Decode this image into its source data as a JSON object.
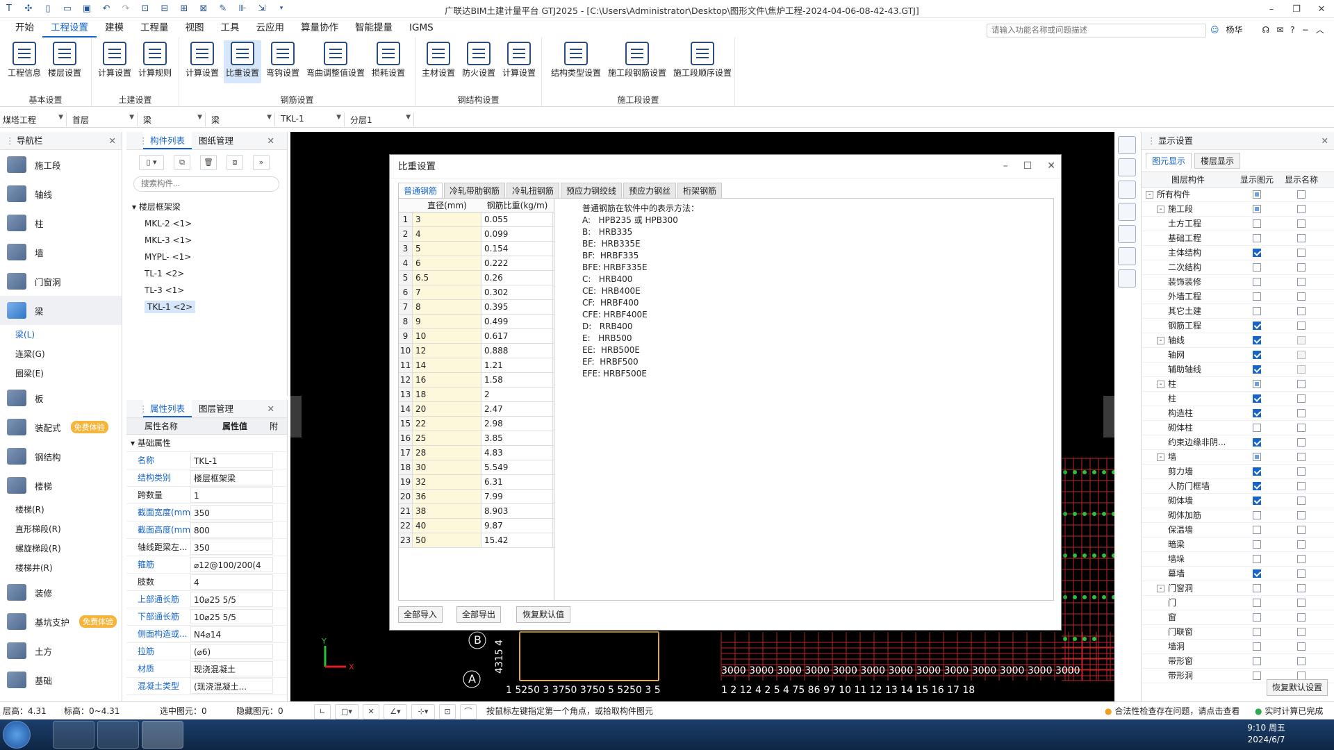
{
  "titlebar": {
    "title": "广联达BIM土建计量平台 GTJ2025 - [C:\\Users\\Administrator\\Desktop\\图形文件\\焦炉工程-2024-04-06-08-42-43.GTJ]"
  },
  "menu": [
    "开始",
    "工程设置",
    "建模",
    "工程量",
    "视图",
    "工具",
    "云应用",
    "算量协作",
    "智能提量",
    "IGMS"
  ],
  "search": {
    "placeholder": "请输入功能名称或问题描述"
  },
  "user": {
    "name": "杨华"
  },
  "ribbon": {
    "groups": [
      {
        "label": "基本设置",
        "buttons": [
          "工程信息",
          "楼层设置"
        ]
      },
      {
        "label": "土建设置",
        "buttons": [
          "计算设置",
          "计算规则"
        ]
      },
      {
        "label": "钢筋设置",
        "buttons": [
          "计算设置",
          "比重设置",
          "弯钩设置",
          "弯曲调整值设置",
          "损耗设置"
        ]
      },
      {
        "label": "钢结构设置",
        "buttons": [
          "主材设置",
          "防火设置",
          "计算设置"
        ]
      },
      {
        "label": "施工段设置",
        "buttons": [
          "结构类型设置",
          "施工段钢筋设置",
          "施工段顺序设置"
        ]
      }
    ]
  },
  "selectors": [
    "煤塔工程",
    "首层",
    "梁",
    "梁",
    "TKL-1",
    "分层1"
  ],
  "nav": {
    "title": "导航栏",
    "items": [
      "施工段",
      "轴线",
      "柱",
      "墙",
      "门窗洞",
      "梁",
      "板",
      "装配式",
      "钢结构",
      "楼梯",
      "装修",
      "基坑支护",
      "土方",
      "基础"
    ],
    "beam_subs": [
      "梁(L)",
      "连梁(G)",
      "圈梁(E)"
    ],
    "stair_subs": [
      "楼梯(R)",
      "直形梯段(R)",
      "螺旋梯段(R)",
      "楼梯井(R)"
    ],
    "badge": "免费体验"
  },
  "complist": {
    "tabs": [
      "构件列表",
      "图纸管理"
    ],
    "search_placeholder": "搜索构件...",
    "group": "楼层框架梁",
    "items": [
      "MKL-2 <1>",
      "MKL-3 <1>",
      "MYPL- <1>",
      "TL-1 <2>",
      "TL-3 <1>",
      "TKL-1 <2>"
    ]
  },
  "props": {
    "tabs": [
      "属性列表",
      "图层管理"
    ],
    "col_name": "属性名称",
    "col_value": "属性值",
    "col_extra": "附",
    "section": "基础属性",
    "rows": [
      {
        "name": "名称",
        "value": "TKL-1"
      },
      {
        "name": "结构类别",
        "value": "楼层框架梁"
      },
      {
        "name": "跨数量",
        "value": "1"
      },
      {
        "name": "截面宽度(mm)",
        "value": "350"
      },
      {
        "name": "截面高度(mm)",
        "value": "800"
      },
      {
        "name": "轴线距梁左...",
        "value": "350"
      },
      {
        "name": "箍筋",
        "value": "⌀12@100/200(4"
      },
      {
        "name": "肢数",
        "value": "4"
      },
      {
        "name": "上部通长筋",
        "value": "10⌀25 5/5"
      },
      {
        "name": "下部通长筋",
        "value": "10⌀25 5/5"
      },
      {
        "name": "侧面构造或...",
        "value": "N4⌀14"
      },
      {
        "name": "拉筋",
        "value": "(⌀6)"
      },
      {
        "name": "材质",
        "value": "现浇混凝土"
      },
      {
        "name": "混凝土类型",
        "value": "(现浇混凝土..."
      }
    ]
  },
  "dialog": {
    "title": "比重设置",
    "tabs": [
      "普通钢筋",
      "冷轧带肋钢筋",
      "冷轧扭钢筋",
      "预应力钢绞线",
      "预应力钢丝",
      "桁架钢筋"
    ],
    "col_dia": "直径(mm)",
    "col_weight": "钢筋比重(kg/m)",
    "rows": [
      {
        "n": "1",
        "d": "3",
        "w": "0.055"
      },
      {
        "n": "2",
        "d": "4",
        "w": "0.099"
      },
      {
        "n": "3",
        "d": "5",
        "w": "0.154"
      },
      {
        "n": "4",
        "d": "6",
        "w": "0.222"
      },
      {
        "n": "5",
        "d": "6.5",
        "w": "0.26"
      },
      {
        "n": "6",
        "d": "7",
        "w": "0.302"
      },
      {
        "n": "7",
        "d": "8",
        "w": "0.395"
      },
      {
        "n": "8",
        "d": "9",
        "w": "0.499"
      },
      {
        "n": "9",
        "d": "10",
        "w": "0.617"
      },
      {
        "n": "10",
        "d": "12",
        "w": "0.888"
      },
      {
        "n": "11",
        "d": "14",
        "w": "1.21"
      },
      {
        "n": "12",
        "d": "16",
        "w": "1.58"
      },
      {
        "n": "13",
        "d": "18",
        "w": "2"
      },
      {
        "n": "14",
        "d": "20",
        "w": "2.47"
      },
      {
        "n": "15",
        "d": "22",
        "w": "2.98"
      },
      {
        "n": "16",
        "d": "25",
        "w": "3.85"
      },
      {
        "n": "17",
        "d": "28",
        "w": "4.83"
      },
      {
        "n": "18",
        "d": "30",
        "w": "5.549"
      },
      {
        "n": "19",
        "d": "32",
        "w": "6.31"
      },
      {
        "n": "20",
        "d": "36",
        "w": "7.99"
      },
      {
        "n": "21",
        "d": "38",
        "w": "8.903"
      },
      {
        "n": "22",
        "d": "40",
        "w": "9.87"
      },
      {
        "n": "23",
        "d": "50",
        "w": "15.42"
      }
    ],
    "description": "普通钢筋在软件中的表示方法：\nA:   HPB235 或 HPB300\nB:   HRB335\nBE:  HRB335E\nBF:  HRBF335\nBFE: HRBF335E\nC:   HRB400\nCE:  HRB400E\nCF:  HRBF400\nCFE: HRBF400E\nD:   RRB400\nE:   HRB500\nEE:  HRB500E\nEF:  HRBF500\nEFE: HRBF500E",
    "buttons": [
      "全部导入",
      "全部导出",
      "恢复默认值"
    ]
  },
  "display": {
    "title": "显示设置",
    "tabs": [
      "图元显示",
      "楼层显示"
    ],
    "col1": "图层构件",
    "col2": "显示图元",
    "col3": "显示名称",
    "rows": [
      {
        "name": "所有构件",
        "lvl": 0,
        "tg": "-",
        "a": "part",
        "b": "off"
      },
      {
        "name": "施工段",
        "lvl": 1,
        "tg": "-",
        "a": "part",
        "b": "off"
      },
      {
        "name": "土方工程",
        "lvl": 2,
        "a": "off",
        "b": "off"
      },
      {
        "name": "基础工程",
        "lvl": 2,
        "a": "off",
        "b": "off"
      },
      {
        "name": "主体结构",
        "lvl": 2,
        "a": "on",
        "b": "off"
      },
      {
        "name": "二次结构",
        "lvl": 2,
        "a": "off",
        "b": "off"
      },
      {
        "name": "装饰装修",
        "lvl": 2,
        "a": "off",
        "b": "off"
      },
      {
        "name": "外墙工程",
        "lvl": 2,
        "a": "off",
        "b": "off"
      },
      {
        "name": "其它土建",
        "lvl": 2,
        "a": "off",
        "b": "off"
      },
      {
        "name": "钢筋工程",
        "lvl": 2,
        "a": "on",
        "b": "off"
      },
      {
        "name": "轴线",
        "lvl": 1,
        "tg": "-",
        "a": "on",
        "b": "gray"
      },
      {
        "name": "轴网",
        "lvl": 2,
        "a": "on",
        "b": "gray"
      },
      {
        "name": "辅助轴线",
        "lvl": 2,
        "a": "on",
        "b": "gray"
      },
      {
        "name": "柱",
        "lvl": 1,
        "tg": "-",
        "a": "part",
        "b": "off"
      },
      {
        "name": "柱",
        "lvl": 2,
        "a": "on",
        "b": "off"
      },
      {
        "name": "构造柱",
        "lvl": 2,
        "a": "on",
        "b": "off"
      },
      {
        "name": "砌体柱",
        "lvl": 2,
        "a": "off",
        "b": "off"
      },
      {
        "name": "约束边缘非阴...",
        "lvl": 2,
        "a": "on",
        "b": "off"
      },
      {
        "name": "墙",
        "lvl": 1,
        "tg": "-",
        "a": "part",
        "b": "off"
      },
      {
        "name": "剪力墙",
        "lvl": 2,
        "a": "on",
        "b": "off"
      },
      {
        "name": "人防门框墙",
        "lvl": 2,
        "a": "on",
        "b": "off"
      },
      {
        "name": "砌体墙",
        "lvl": 2,
        "a": "on",
        "b": "off"
      },
      {
        "name": "砌体加筋",
        "lvl": 2,
        "a": "off",
        "b": "off"
      },
      {
        "name": "保温墙",
        "lvl": 2,
        "a": "off",
        "b": "off"
      },
      {
        "name": "暗梁",
        "lvl": 2,
        "a": "off",
        "b": "off"
      },
      {
        "name": "墙垛",
        "lvl": 2,
        "a": "off",
        "b": "off"
      },
      {
        "name": "幕墙",
        "lvl": 2,
        "a": "on",
        "b": "off"
      },
      {
        "name": "门窗洞",
        "lvl": 1,
        "tg": "-",
        "a": "off",
        "b": "off"
      },
      {
        "name": "门",
        "lvl": 2,
        "a": "off",
        "b": "off"
      },
      {
        "name": "窗",
        "lvl": 2,
        "a": "off",
        "b": "off"
      },
      {
        "name": "门联窗",
        "lvl": 2,
        "a": "off",
        "b": "off"
      },
      {
        "name": "墙洞",
        "lvl": 2,
        "a": "off",
        "b": "off"
      },
      {
        "name": "带形窗",
        "lvl": 2,
        "a": "off",
        "b": "off"
      },
      {
        "name": "带形洞",
        "lvl": 2,
        "a": "off",
        "b": "off"
      }
    ],
    "restore": "恢复默认设置"
  },
  "status": {
    "floor_h": "层高：4.31",
    "elev": "标高：0~4.31",
    "selected": "选中图元：0",
    "hidden": "隐藏图元：0",
    "hint": "按鼠标左键指定第一个角点，或拾取构件图元",
    "check": "合法性检查存在问题，请点击查看",
    "realtime": "实时计算已完成"
  },
  "taskbar": {
    "time": "9:10 周五",
    "date": "2024/6/7"
  },
  "canvas_texts": {
    "axis_b": "B",
    "axis_a": "A",
    "dim_left": "4315 4",
    "dims_bottom": "1 5250 3 3750 3750 5 5250 3 5",
    "dim_right": "3000 3000 3000 3000 3000 3000 3000 3000 3000 3000 3000 3000 3000",
    "nums_right": "1  2  12  4 2 5 4  75  86  97  10 11  12 13 14 15 16 17 18"
  },
  "colors": {
    "accent": "#1764c8",
    "canvas": "#000000",
    "grid_red": "#c0282a",
    "grid_green": "#2fbf3f"
  }
}
